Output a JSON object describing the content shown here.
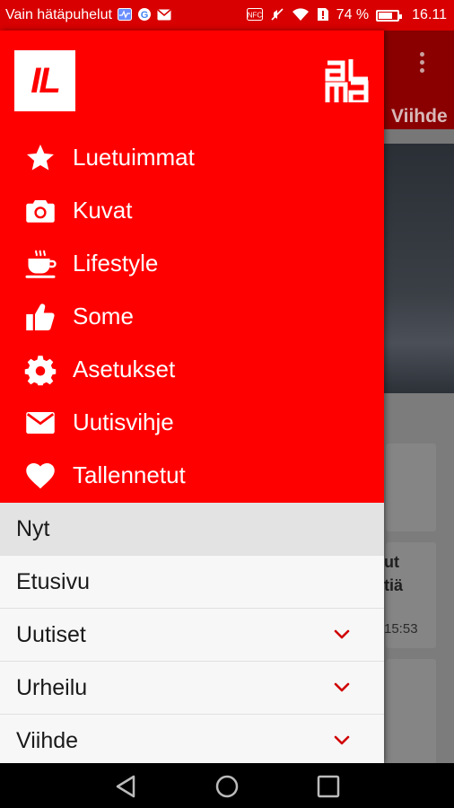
{
  "status_bar": {
    "carrier": "Vain hätäpuhelut",
    "battery_percent": "74 %",
    "battery_level": 0.74,
    "time": "16.11"
  },
  "background": {
    "tab_label": "Viihde",
    "story_text_line1": "ut",
    "story_text_line2": "tiä",
    "story_time": "15:53"
  },
  "drawer": {
    "logo_text": "IL",
    "partner_logo_text": "alma",
    "nav_items": [
      {
        "label": "Luetuimmat",
        "icon": "star-icon"
      },
      {
        "label": "Kuvat",
        "icon": "camera-icon"
      },
      {
        "label": "Lifestyle",
        "icon": "coffee-cup-icon"
      },
      {
        "label": "Some",
        "icon": "thumbs-up-icon"
      },
      {
        "label": "Asetukset",
        "icon": "gear-icon"
      },
      {
        "label": "Uutisvihje",
        "icon": "envelope-icon"
      },
      {
        "label": "Tallennetut",
        "icon": "heart-icon"
      }
    ],
    "sections": [
      {
        "label": "Nyt",
        "expandable": false,
        "active": true
      },
      {
        "label": "Etusivu",
        "expandable": false,
        "active": false
      },
      {
        "label": "Uutiset",
        "expandable": true,
        "active": false
      },
      {
        "label": "Urheilu",
        "expandable": true,
        "active": false
      },
      {
        "label": "Viihde",
        "expandable": true,
        "active": false
      }
    ]
  },
  "colors": {
    "brand_red": "#ff0000",
    "status_red": "#d80000",
    "chevron_red": "#d00000"
  }
}
